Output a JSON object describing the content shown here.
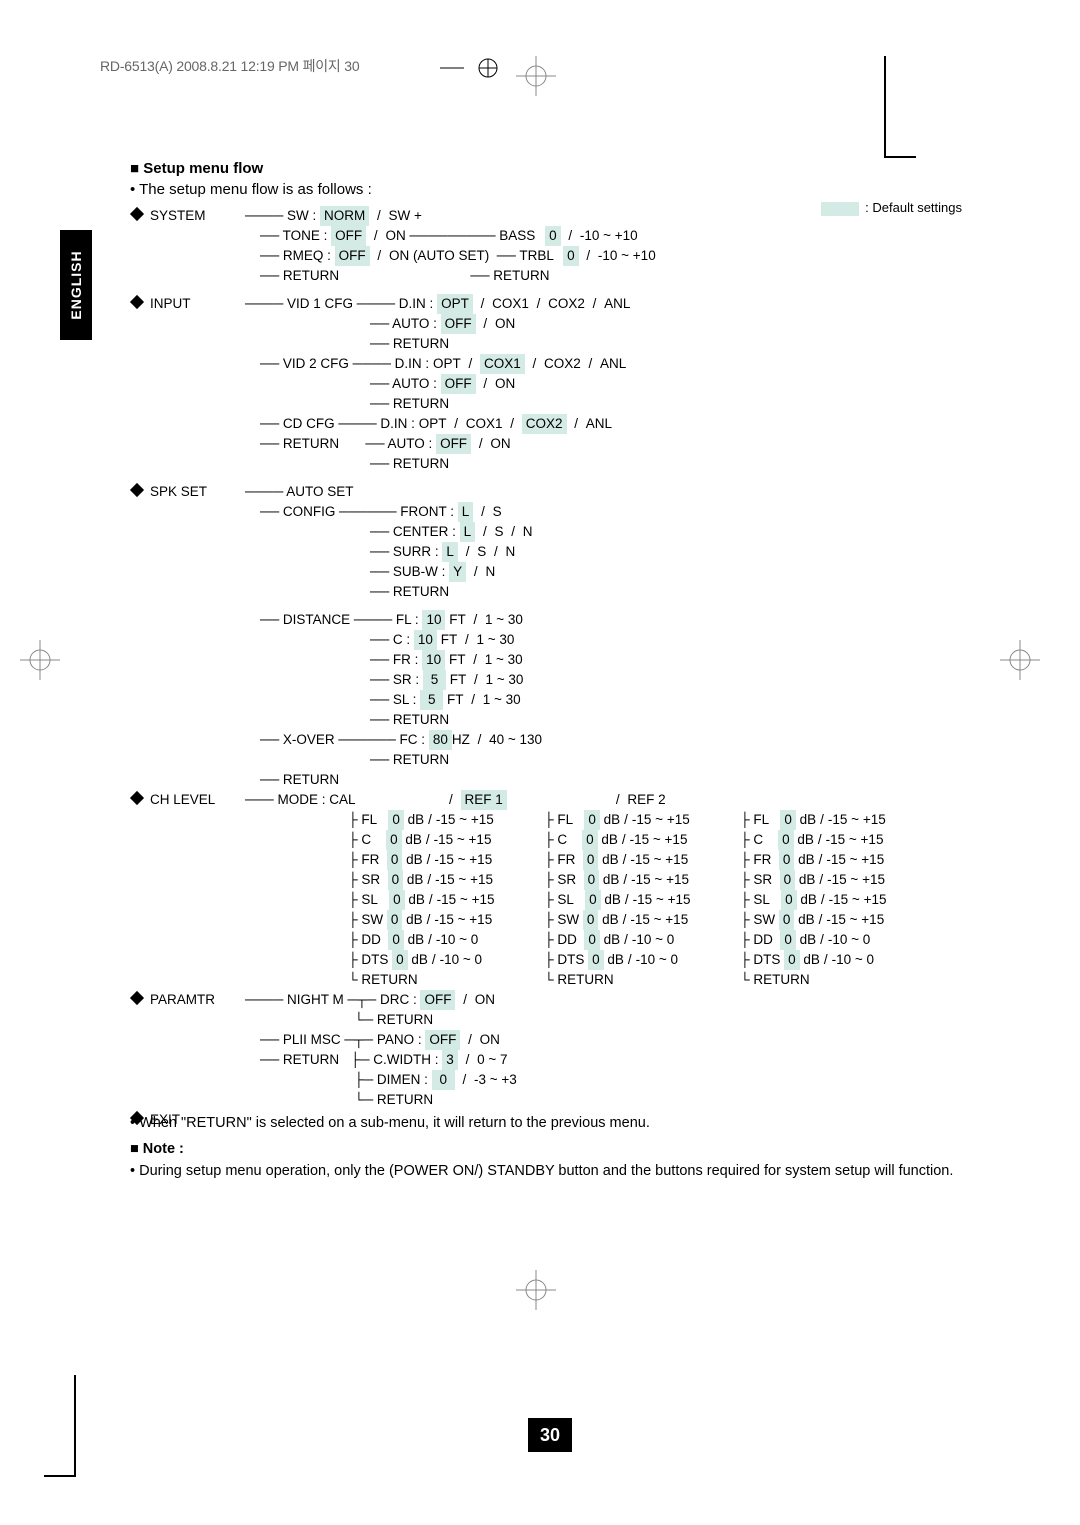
{
  "header": "RD-6513(A)  2008.8.21  12:19 PM   페이지 30",
  "title": "■ Setup menu flow",
  "intro": "• The setup menu flow is as follows :",
  "legend": ": Default settings",
  "pagenum": "30",
  "foot": {
    "l1": "• When \"RETURN\" is selected on a sub-menu, it will return to the previous menu.",
    "l2": "■ Note :",
    "l3": "• During setup menu operation, only the (POWER ON/) STANDBY button and the buttons required for system setup will function."
  },
  "english": "ENGLISH",
  "labels": {
    "system": "SYSTEM",
    "input": "INPUT",
    "spkset": "SPK SET",
    "chlevel": "CH LEVEL",
    "paramtr": "PARAMTR",
    "exit": "EXIT",
    "return": "RETURN",
    "sw": "SW :",
    "swplus": "SW +",
    "norm": "NORM",
    "tone": "TONE :",
    "off": "OFF",
    "on": "ON",
    "onauto": "ON (AUTO SET)",
    "rmeq": "RMEQ :",
    "bass": "BASS",
    "trbl": "TRBL",
    "range10": "-10 ~ +10",
    "zero": "0",
    "vid1": "VID 1 CFG",
    "vid2": "VID 2 CFG",
    "cdcfg": "CD   CFG",
    "din": "D.IN :",
    "opt": "OPT",
    "cox1": "COX1",
    "cox2": "COX2",
    "anl": "ANL",
    "auto": "AUTO :",
    "autoset": "AUTO SET",
    "config": "CONFIG",
    "distance": "DISTANCE",
    "xover": "X-OVER",
    "front": "FRONT   :",
    "center": "CENTER :",
    "surr": "SURR     :",
    "subw": "SUB-W   :",
    "L": "L",
    "S": "S",
    "N": "N",
    "Y": "Y",
    "fl": "FL   :",
    "c": "C    :",
    "fr": "FR  :",
    "sr": "SR  :",
    "sl": "SL   :",
    "ft": "FT",
    "d10": "10",
    "d5": "5",
    "drange": "1 ~ 30",
    "fc": "FC       :",
    "hz": "HZ",
    "fcv": "80",
    "fcrange": "40 ~ 130",
    "modecal": "MODE  : CAL",
    "ref1": "REF 1",
    "ref2": "REF 2",
    "chFL": "FL",
    "chC": "C",
    "chFR": "FR",
    "chSR": "SR",
    "chSL": "SL",
    "chSW": "SW",
    "chDD": "DD",
    "chDTS": "DTS",
    "db": "dB",
    "r15": "-15 ~ +15",
    "r10": "-10 ~ 0",
    "nightm": "NIGHT  M",
    "plii": "PLII  MSC",
    "drc": "DRC      :",
    "pano": "PANO   :",
    "cwidth": "C.WIDTH  :",
    "dimen": "DIMEN    :",
    "cwv": "3",
    "cwrange": "0 ~ 7",
    "dimv": "0",
    "dimrange": "-3 ~ +3"
  }
}
